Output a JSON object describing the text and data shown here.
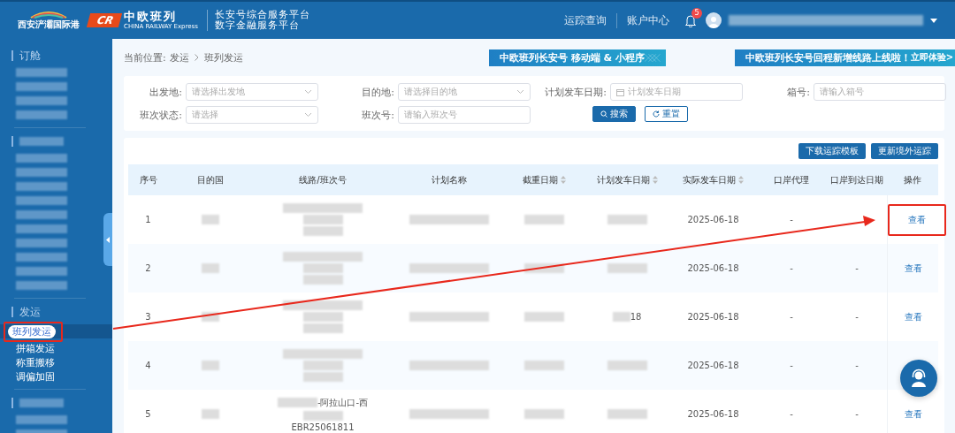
{
  "header": {
    "port_logo": "西安浐灞国际港",
    "cr_mark": "CR",
    "cr_name": "中欧班列",
    "cr_sub": "CHINA RAILWAY Express",
    "platform_lines": [
      "长安号综合服务平台",
      "数字金融服务平台"
    ],
    "nav": [
      "运踪查询",
      "账户中心"
    ],
    "notifications": "5",
    "user": {
      "kind": "blurred"
    }
  },
  "sidebar": {
    "sections": [
      {
        "title": {
          "kind": "text",
          "text": "订舱"
        },
        "items": [
          {
            "kind": "blurred"
          },
          {
            "kind": "blurred"
          },
          {
            "kind": "blurred"
          },
          {
            "kind": "blurred"
          }
        ]
      },
      {
        "title": {
          "kind": "blurred"
        },
        "items": [
          {
            "kind": "blurred"
          },
          {
            "kind": "blurred"
          },
          {
            "kind": "blurred"
          },
          {
            "kind": "blurred"
          },
          {
            "kind": "blurred"
          },
          {
            "kind": "blurred"
          },
          {
            "kind": "blurred"
          },
          {
            "kind": "blurred"
          },
          {
            "kind": "blurred"
          },
          {
            "kind": "blurred"
          }
        ]
      },
      {
        "title": {
          "kind": "text",
          "text": "发运"
        },
        "items": [
          {
            "kind": "text",
            "text": "班列发运",
            "selected": true,
            "annotated": true
          },
          {
            "kind": "text",
            "text": "拼箱发运",
            "selected": false,
            "annotated": false
          },
          {
            "kind": "text",
            "text": "称重搬移",
            "selected": false,
            "annotated": false
          },
          {
            "kind": "text",
            "text": "调偏加固",
            "selected": false,
            "annotated": false
          }
        ]
      },
      {
        "title": {
          "kind": "blurred"
        },
        "items": [
          {
            "kind": "blurred"
          },
          {
            "kind": "blurred"
          }
        ]
      }
    ]
  },
  "breadcrumb": {
    "label": "当前位置:",
    "path": [
      "发运",
      "班列发运"
    ]
  },
  "banners": [
    {
      "text": "中欧班列长安号 移动端 & 小程序"
    },
    {
      "text": "中欧班列长安号回程新增线路上线啦！",
      "cta": "立即体验>"
    }
  ],
  "filters": [
    {
      "label": "出发地:",
      "kind": "select",
      "placeholder": "请选择出发地"
    },
    {
      "label": "目的地:",
      "kind": "select",
      "placeholder": "请选择目的地"
    },
    {
      "label": "计划发车日期:",
      "kind": "date",
      "placeholder": "计划发车日期"
    },
    {
      "label": "箱号:",
      "kind": "input",
      "placeholder": "请输入箱号"
    },
    {
      "label": "班次状态:",
      "kind": "select",
      "placeholder": "请选择"
    },
    {
      "label": "班次号:",
      "kind": "input",
      "placeholder": "请输入班次号"
    }
  ],
  "filter_buttons": [
    {
      "label": "搜索",
      "kind": "primary"
    },
    {
      "label": "重置",
      "kind": "secondary"
    }
  ],
  "toolbar_buttons": [
    "下载运踪模板",
    "更新境外运踪"
  ],
  "table": {
    "columns": [
      {
        "label": "序号",
        "sortable": false
      },
      {
        "label": "目的国",
        "sortable": false
      },
      {
        "label": "线路/班次号",
        "sortable": false
      },
      {
        "label": "计划名称",
        "sortable": false
      },
      {
        "label": "截重日期",
        "sortable": true
      },
      {
        "label": "计划发车日期",
        "sortable": true
      },
      {
        "label": "实际发车日期",
        "sortable": true
      },
      {
        "label": "口岸代理",
        "sortable": false
      },
      {
        "label": "口岸到达日期",
        "sortable": false
      },
      {
        "label": "操作",
        "sortable": false
      }
    ],
    "rows": [
      {
        "cells": [
          {
            "lines": [
              {
                "parts": [
                  {
                    "kind": "text",
                    "text": "1"
                  }
                ]
              }
            ]
          },
          {
            "lines": [
              {
                "parts": [
                  {
                    "kind": "blurred-small"
                  }
                ]
              }
            ]
          },
          {
            "lines": [
              {
                "parts": [
                  {
                    "kind": "blurred-wide"
                  }
                ]
              },
              {
                "parts": [
                  {
                    "kind": "blurred-medium"
                  }
                ]
              },
              {
                "parts": [
                  {
                    "kind": "blurred-medium"
                  }
                ]
              }
            ]
          },
          {
            "lines": [
              {
                "parts": [
                  {
                    "kind": "blurred-wide"
                  }
                ]
              }
            ]
          },
          {
            "lines": [
              {
                "parts": [
                  {
                    "kind": "blurred-medium"
                  }
                ]
              }
            ]
          },
          {
            "lines": [
              {
                "parts": [
                  {
                    "kind": "blurred-medium"
                  }
                ]
              }
            ]
          },
          {
            "lines": [
              {
                "parts": [
                  {
                    "kind": "text",
                    "text": "2025-06-18"
                  }
                ]
              }
            ]
          },
          {
            "lines": [
              {
                "parts": [
                  {
                    "kind": "text",
                    "text": "-"
                  }
                ]
              }
            ]
          },
          null
        ],
        "action": {
          "text": "查看",
          "annotated": true
        }
      },
      {
        "cells": [
          {
            "lines": [
              {
                "parts": [
                  {
                    "kind": "text",
                    "text": "2"
                  }
                ]
              }
            ]
          },
          {
            "lines": [
              {
                "parts": [
                  {
                    "kind": "blurred-small"
                  }
                ]
              }
            ]
          },
          {
            "lines": [
              {
                "parts": [
                  {
                    "kind": "blurred-wide"
                  }
                ]
              },
              {
                "parts": [
                  {
                    "kind": "blurred-medium"
                  }
                ]
              },
              {
                "parts": [
                  {
                    "kind": "blurred-medium"
                  }
                ]
              }
            ]
          },
          {
            "lines": [
              {
                "parts": [
                  {
                    "kind": "blurred-wide"
                  }
                ]
              }
            ]
          },
          {
            "lines": [
              {
                "parts": [
                  {
                    "kind": "blurred-medium"
                  }
                ]
              }
            ]
          },
          {
            "lines": [
              {
                "parts": [
                  {
                    "kind": "blurred-medium"
                  }
                ]
              }
            ]
          },
          {
            "lines": [
              {
                "parts": [
                  {
                    "kind": "text",
                    "text": "2025-06-18"
                  }
                ]
              }
            ]
          },
          {
            "lines": [
              {
                "parts": [
                  {
                    "kind": "text",
                    "text": "-"
                  }
                ]
              }
            ]
          },
          {
            "lines": [
              {
                "parts": [
                  {
                    "kind": "text",
                    "text": "-"
                  }
                ]
              }
            ]
          }
        ],
        "action": {
          "text": "查看",
          "annotated": false
        }
      },
      {
        "cells": [
          {
            "lines": [
              {
                "parts": [
                  {
                    "kind": "text",
                    "text": "3"
                  }
                ]
              }
            ]
          },
          {
            "lines": [
              {
                "parts": [
                  {
                    "kind": "blurred-small"
                  }
                ]
              }
            ]
          },
          {
            "lines": [
              {
                "parts": [
                  {
                    "kind": "blurred-wide"
                  }
                ]
              },
              {
                "parts": [
                  {
                    "kind": "blurred-medium"
                  }
                ]
              },
              {
                "parts": [
                  {
                    "kind": "blurred-medium"
                  }
                ]
              }
            ]
          },
          {
            "lines": [
              {
                "parts": [
                  {
                    "kind": "blurred-wide"
                  }
                ]
              }
            ]
          },
          {
            "lines": [
              {
                "parts": [
                  {
                    "kind": "blurred-medium"
                  }
                ]
              }
            ]
          },
          {
            "lines": [
              {
                "parts": [
                  {
                    "kind": "blurred-small"
                  },
                  {
                    "kind": "text",
                    "text": "18"
                  }
                ]
              }
            ]
          },
          {
            "lines": [
              {
                "parts": [
                  {
                    "kind": "text",
                    "text": "2025-06-18"
                  }
                ]
              }
            ]
          },
          {
            "lines": [
              {
                "parts": [
                  {
                    "kind": "text",
                    "text": "-"
                  }
                ]
              }
            ]
          },
          {
            "lines": [
              {
                "parts": [
                  {
                    "kind": "text",
                    "text": "-"
                  }
                ]
              }
            ]
          }
        ],
        "action": {
          "text": "查看",
          "annotated": false
        }
      },
      {
        "cells": [
          {
            "lines": [
              {
                "parts": [
                  {
                    "kind": "text",
                    "text": "4"
                  }
                ]
              }
            ]
          },
          {
            "lines": [
              {
                "parts": [
                  {
                    "kind": "blurred-small"
                  }
                ]
              }
            ]
          },
          {
            "lines": [
              {
                "parts": [
                  {
                    "kind": "blurred-wide"
                  }
                ]
              },
              {
                "parts": [
                  {
                    "kind": "blurred-medium"
                  }
                ]
              },
              {
                "parts": [
                  {
                    "kind": "blurred-medium"
                  }
                ]
              }
            ]
          },
          {
            "lines": [
              {
                "parts": [
                  {
                    "kind": "blurred-wide"
                  }
                ]
              }
            ]
          },
          {
            "lines": [
              {
                "parts": [
                  {
                    "kind": "blurred-medium"
                  }
                ]
              }
            ]
          },
          {
            "lines": [
              {
                "parts": [
                  {
                    "kind": "blurred-medium"
                  }
                ]
              }
            ]
          },
          {
            "lines": [
              {
                "parts": [
                  {
                    "kind": "text",
                    "text": "2025-06-18"
                  }
                ]
              }
            ]
          },
          {
            "lines": [
              {
                "parts": [
                  {
                    "kind": "text",
                    "text": "-"
                  }
                ]
              }
            ]
          },
          {
            "lines": [
              {
                "parts": [
                  {
                    "kind": "text",
                    "text": "-"
                  }
                ]
              }
            ]
          }
        ]
      },
      {
        "cells": [
          {
            "lines": [
              {
                "parts": [
                  {
                    "kind": "text",
                    "text": "5"
                  }
                ]
              }
            ]
          },
          {
            "lines": [
              {
                "parts": [
                  {
                    "kind": "blurred-small"
                  }
                ]
              }
            ]
          },
          {
            "lines": [
              {
                "parts": [
                  {
                    "kind": "blurred-medium"
                  },
                  {
                    "kind": "text",
                    "text": "-阿拉山口-西"
                  }
                ]
              },
              {
                "parts": [
                  {
                    "kind": "blurred-medium"
                  }
                ]
              },
              {
                "parts": [
                  {
                    "kind": "text",
                    "text": "EBR25061811"
                  }
                ]
              }
            ]
          },
          {
            "lines": [
              {
                "parts": [
                  {
                    "kind": "blurred-wide"
                  }
                ]
              }
            ]
          },
          {
            "lines": [
              {
                "parts": [
                  {
                    "kind": "blurred-medium"
                  }
                ]
              }
            ]
          },
          {
            "lines": [
              {
                "parts": [
                  {
                    "kind": "blurred-medium"
                  }
                ]
              }
            ]
          },
          {
            "lines": [
              {
                "parts": [
                  {
                    "kind": "text",
                    "text": "2025-06-18"
                  }
                ]
              }
            ]
          },
          {
            "lines": [
              {
                "parts": [
                  {
                    "kind": "text",
                    "text": "-"
                  }
                ]
              }
            ]
          },
          {
            "lines": [
              {
                "parts": [
                  {
                    "kind": "text",
                    "text": "-"
                  }
                ]
              }
            ]
          }
        ],
        "action": {
          "text": "查看",
          "annotated": false
        }
      }
    ]
  },
  "annotation_arrow": true
}
